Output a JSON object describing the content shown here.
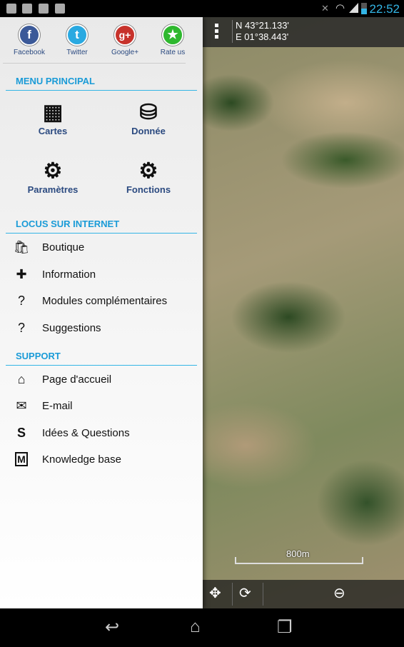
{
  "status": {
    "time": "22:52",
    "icons": [
      "camera-icon",
      "play-store-icon",
      "play-store-icon",
      "play-store-icon",
      "mute-icon",
      "wifi-icon",
      "signal-icon",
      "battery-icon"
    ]
  },
  "social": [
    {
      "label": "Facebook",
      "glyph": "f",
      "color": "#3b5998"
    },
    {
      "label": "Twitter",
      "glyph": "t",
      "color": "#29a9e1"
    },
    {
      "label": "Google+",
      "glyph": "g+",
      "color": "#c7322b"
    },
    {
      "label": "Rate us",
      "glyph": "★",
      "color": "#2eb82e"
    }
  ],
  "menu_principal": {
    "title": "MENU PRINCIPAL",
    "items": [
      {
        "label": "Cartes",
        "icon": "▦"
      },
      {
        "label": "Donnée",
        "icon": "⛁"
      },
      {
        "label": "Paramètres",
        "icon": "⚙"
      },
      {
        "label": "Fonctions",
        "icon": "⚙"
      }
    ]
  },
  "locus_internet": {
    "title": "LOCUS SUR INTERNET",
    "items": [
      {
        "label": "Boutique",
        "icon": "🛍"
      },
      {
        "label": "Information",
        "icon": "✚"
      },
      {
        "label": "Modules complémentaires",
        "icon": "?"
      },
      {
        "label": "Suggestions",
        "icon": "?"
      }
    ]
  },
  "support": {
    "title": "SUPPORT",
    "items": [
      {
        "label": "Page d'accueil",
        "icon": "⌂"
      },
      {
        "label": "E-mail",
        "icon": "✉"
      },
      {
        "label": "Idées & Questions",
        "icon": "S"
      },
      {
        "label": "Knowledge base",
        "icon": "M"
      }
    ]
  },
  "map": {
    "lat": "N 43°21.133'",
    "lon": "E 01°38.443'",
    "scale": "800m"
  }
}
